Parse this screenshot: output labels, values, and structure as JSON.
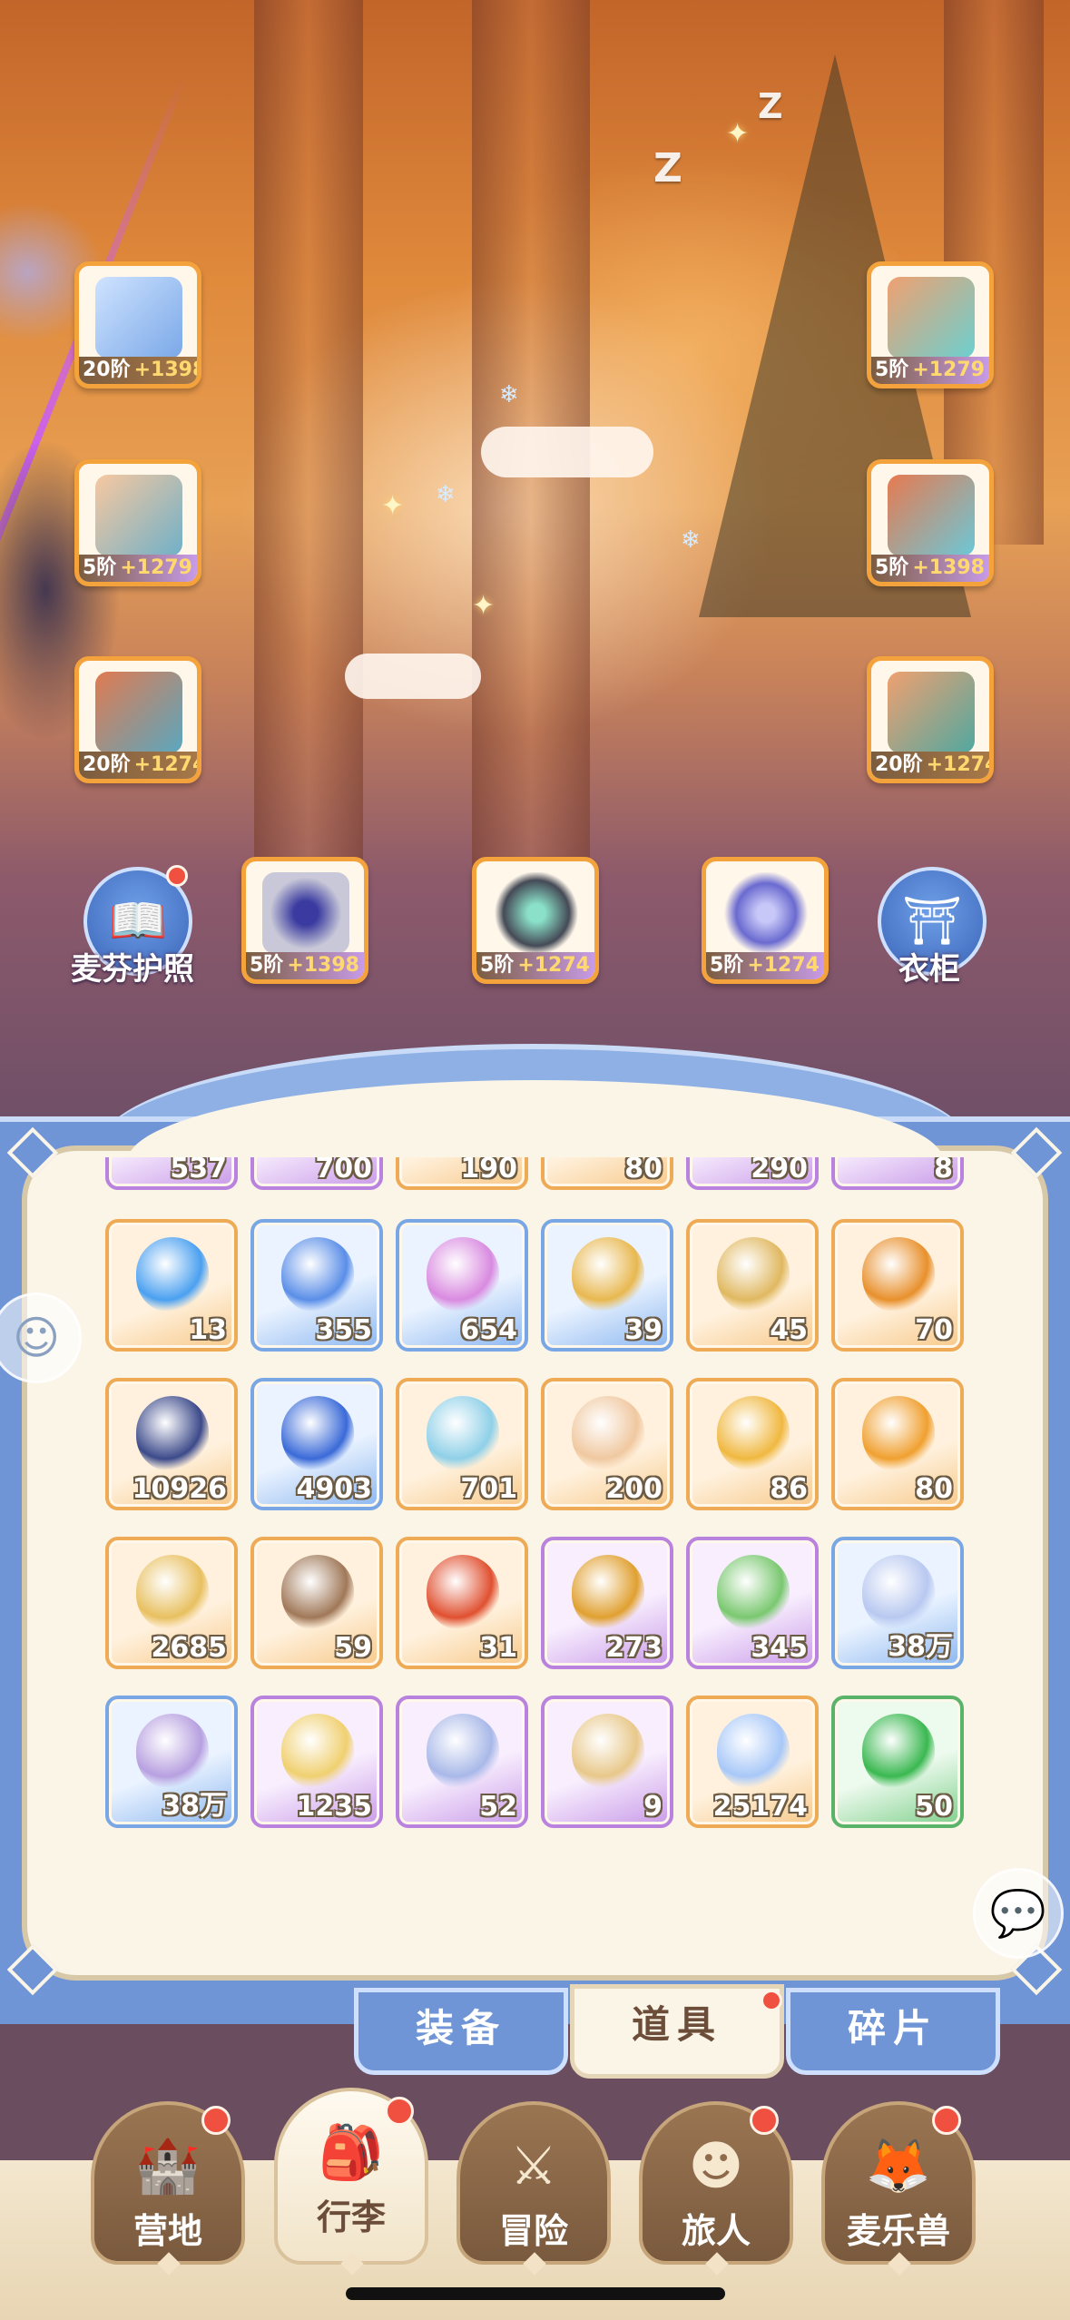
{
  "equipment": {
    "left": [
      {
        "tier": "20阶",
        "bonus": "+1398",
        "icon": "sword-icon",
        "color": "#8fc0ff"
      },
      {
        "tier": "5阶",
        "bonus": "+1279",
        "icon": "armor-icon",
        "color": "#e8a070"
      },
      {
        "tier": "20阶",
        "bonus": "+1274",
        "icon": "belt-icon",
        "color": "#6fb0c8"
      }
    ],
    "right": [
      {
        "tier": "5阶",
        "bonus": "+1279",
        "icon": "helmet-icon",
        "color": "#6bd0d0"
      },
      {
        "tier": "5阶",
        "bonus": "+1398",
        "icon": "gauntlet-icon",
        "color": "#e77a50"
      },
      {
        "tier": "20阶",
        "bonus": "+1274",
        "icon": "boots-icon",
        "color": "#f0a070"
      }
    ],
    "bottom": [
      {
        "tier": "5阶",
        "bonus": "+1398",
        "icon": "ring-icon",
        "color": "#7a72d8"
      },
      {
        "tier": "5阶",
        "bonus": "+1274",
        "icon": "necklace-icon",
        "color": "#6a7a86"
      },
      {
        "tier": "5阶",
        "bonus": "+1274",
        "icon": "amulet-icon",
        "color": "#8a8ae0"
      }
    ]
  },
  "buttons": {
    "passport": {
      "label": "麦芬护照",
      "icon": "passport-book-icon"
    },
    "wardrobe": {
      "label": "衣柜",
      "icon": "wardrobe-icon"
    }
  },
  "inventory": {
    "partial_row": [
      {
        "count": "537",
        "tint": "purple"
      },
      {
        "count": "700",
        "tint": "purple"
      },
      {
        "count": "190",
        "tint": "orange"
      },
      {
        "count": "80",
        "tint": "orange"
      },
      {
        "count": "290",
        "tint": "purple"
      },
      {
        "count": "8",
        "tint": "purple"
      }
    ],
    "rows": [
      [
        {
          "count": "13",
          "tint": "orange",
          "icon": "blue-potion-icon",
          "color": "#4aa0f0"
        },
        {
          "count": "355",
          "tint": "blue",
          "icon": "ticket-3-icon",
          "color": "#5a8ee8"
        },
        {
          "count": "654",
          "tint": "blue",
          "icon": "pink-ticket-icon",
          "color": "#d98ae0"
        },
        {
          "count": "39",
          "tint": "blue",
          "icon": "gold-ticket-icon",
          "color": "#e8b850"
        },
        {
          "count": "45",
          "tint": "orange",
          "icon": "golden-bell-icon",
          "color": "#e0b860"
        },
        {
          "count": "70",
          "tint": "orange",
          "icon": "cat-coin-icon",
          "color": "#e8902c"
        }
      ],
      [
        {
          "count": "10926",
          "tint": "orange",
          "icon": "rune-orb-icon",
          "color": "#3c4a8a"
        },
        {
          "count": "4903",
          "tint": "blue",
          "icon": "blue-crystal-icon",
          "color": "#3a6ad8"
        },
        {
          "count": "701",
          "tint": "orange",
          "icon": "ice-crystal-icon",
          "color": "#8fd0e8"
        },
        {
          "count": "200",
          "tint": "orange",
          "icon": "rainbow-tube-icon",
          "color": "#f0c8a0"
        },
        {
          "count": "86",
          "tint": "orange",
          "icon": "paint-jar-icon",
          "color": "#f0b840"
        },
        {
          "count": "80",
          "tint": "orange",
          "icon": "card-icon",
          "color": "#f0a030"
        }
      ],
      [
        {
          "count": "2685",
          "tint": "orange",
          "icon": "jingle-bell-icon",
          "color": "#e8c060"
        },
        {
          "count": "59",
          "tint": "orange",
          "icon": "seed-sack-icon",
          "color": "#a07858"
        },
        {
          "count": "31",
          "tint": "orange",
          "icon": "clover-coin-icon",
          "color": "#e05030"
        },
        {
          "count": "273",
          "tint": "purple",
          "icon": "horseshoe-icon",
          "color": "#e0a030"
        },
        {
          "count": "345",
          "tint": "purple",
          "icon": "bottle-icon",
          "color": "#7ac870"
        },
        {
          "count": "38万",
          "tint": "blue",
          "icon": "crystal-dust-icon",
          "color": "#b8c8f0"
        }
      ],
      [
        {
          "count": "38万",
          "tint": "blue",
          "icon": "purple-dust-icon",
          "color": "#b7a0e0"
        },
        {
          "count": "1235",
          "tint": "purple",
          "icon": "cookie-plate-icon",
          "color": "#f0d070"
        },
        {
          "count": "52",
          "tint": "purple",
          "icon": "cat-spoon-icon",
          "color": "#a8b8e8"
        },
        {
          "count": "9",
          "tint": "purple",
          "icon": "paw-sack-icon",
          "color": "#e8c88a"
        },
        {
          "count": "25174",
          "tint": "orange",
          "icon": "star-crystal-icon",
          "color": "#a8c8f8"
        },
        {
          "count": "50",
          "tint": "green",
          "icon": "green-gem-icon",
          "color": "#3ab850"
        }
      ]
    ]
  },
  "tabs": [
    {
      "label": "装备",
      "active": false
    },
    {
      "label": "道具",
      "active": true
    },
    {
      "label": "碎片",
      "active": false
    }
  ],
  "nav": [
    {
      "label": "营地",
      "icon": "castle-icon",
      "badge": true,
      "active": false
    },
    {
      "label": "行李",
      "icon": "backpack-icon",
      "badge": true,
      "active": true
    },
    {
      "label": "冒险",
      "icon": "crossed-swords-icon",
      "badge": false,
      "active": false
    },
    {
      "label": "旅人",
      "icon": "traveler-avatar-icon",
      "badge": true,
      "active": false
    },
    {
      "label": "麦乐兽",
      "icon": "fox-pet-icon",
      "badge": true,
      "active": false
    }
  ],
  "colors": {
    "accent_blue": "#6f95d6",
    "badge_red": "#f05040",
    "panel_cream": "#fbf5e8"
  }
}
